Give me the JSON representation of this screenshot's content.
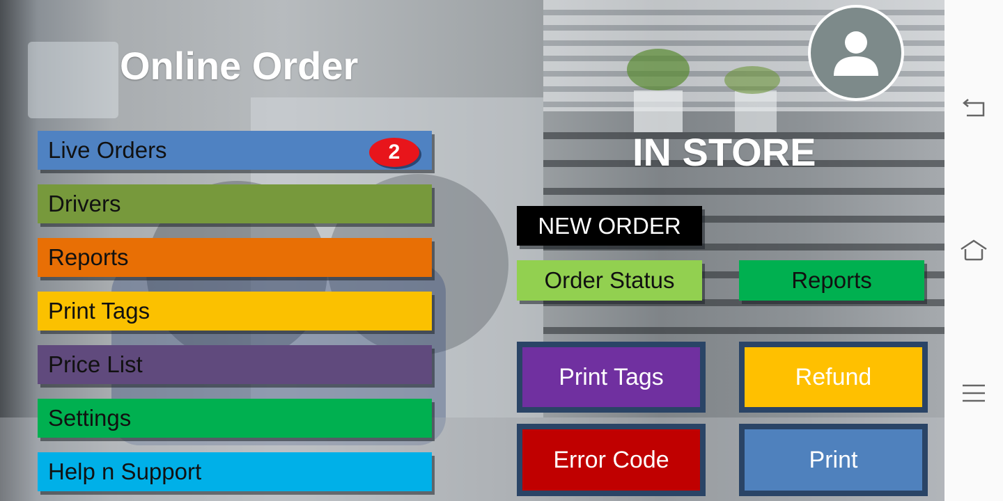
{
  "header": {
    "title": "Online Order"
  },
  "sidebar": {
    "items": [
      {
        "label": "Live Orders",
        "color": "#4f82c2",
        "badge": "2"
      },
      {
        "label": "Drivers",
        "color": "#77993c"
      },
      {
        "label": "Reports",
        "color": "#e86f05"
      },
      {
        "label": "Print Tags",
        "color": "#fbc100"
      },
      {
        "label": "Price List",
        "color": "#604a7d"
      },
      {
        "label": "Settings",
        "color": "#00b050"
      },
      {
        "label": "Help n Support",
        "color": "#00b0e8"
      }
    ]
  },
  "store": {
    "title": "IN STORE",
    "new_order": "NEW ORDER",
    "order_status": "Order Status",
    "reports": "Reports",
    "print_tags": "Print Tags",
    "refund": "Refund",
    "error_code": "Error Code",
    "print": "Print"
  },
  "colors": {
    "new_order": "#000000",
    "order_status": "#92d050",
    "reports": "#00b050",
    "print_tags": "#7030a0",
    "refund": "#ffc000",
    "error_code": "#c00000",
    "print": "#4f81bd",
    "badge": "#e8151b"
  },
  "icons": {
    "avatar": "user-icon",
    "back": "back-icon",
    "home": "home-icon",
    "menu": "menu-icon"
  }
}
